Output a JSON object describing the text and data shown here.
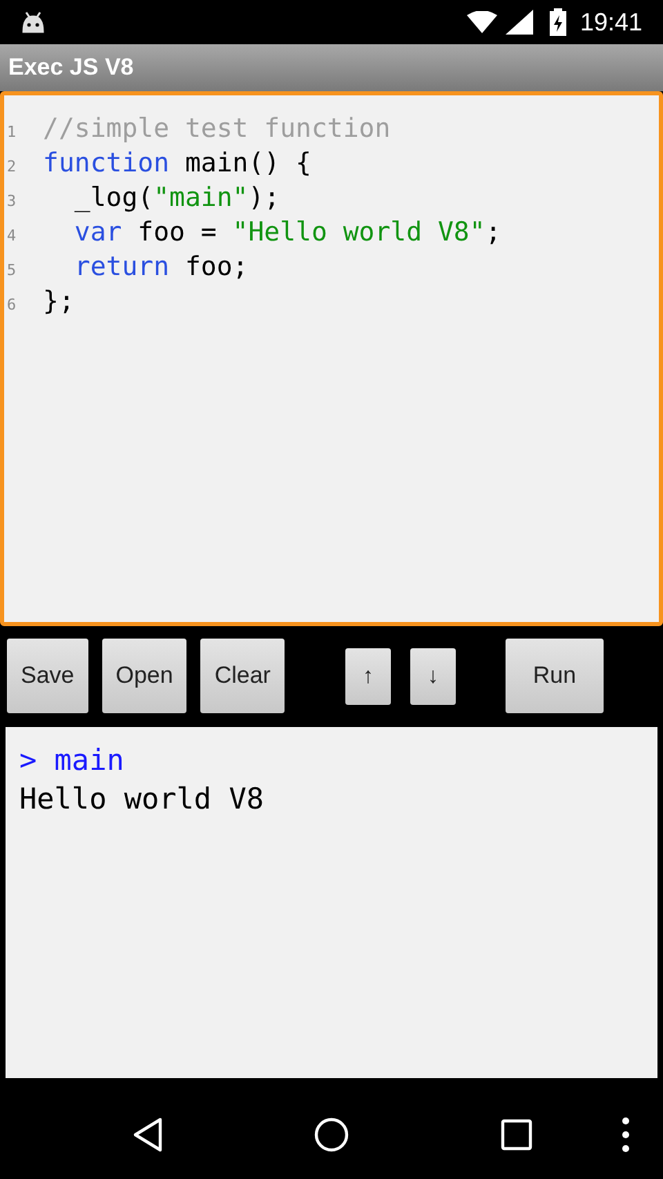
{
  "status_bar": {
    "time": "19:41"
  },
  "app_bar": {
    "title": "Exec JS V8"
  },
  "editor": {
    "focused": true,
    "lines": [
      {
        "number": "1",
        "tokens": [
          {
            "kind": "comment",
            "text": "//simple test function"
          }
        ]
      },
      {
        "number": "2",
        "tokens": [
          {
            "kind": "keyword",
            "text": "function"
          },
          {
            "kind": "plain",
            "text": " main() {"
          }
        ]
      },
      {
        "number": "3",
        "tokens": [
          {
            "kind": "plain",
            "text": "  _log("
          },
          {
            "kind": "string",
            "text": "\"main\""
          },
          {
            "kind": "plain",
            "text": ");"
          }
        ]
      },
      {
        "number": "4",
        "tokens": [
          {
            "kind": "keyword",
            "text": "  var"
          },
          {
            "kind": "plain",
            "text": " foo = "
          },
          {
            "kind": "string",
            "text": "\"Hello world V8\""
          },
          {
            "kind": "plain",
            "text": ";"
          }
        ]
      },
      {
        "number": "5",
        "tokens": [
          {
            "kind": "keyword",
            "text": "  return"
          },
          {
            "kind": "plain",
            "text": " foo;"
          }
        ]
      },
      {
        "number": "6",
        "tokens": [
          {
            "kind": "plain",
            "text": "};"
          }
        ]
      }
    ]
  },
  "toolbar": [
    {
      "label": "Save",
      "kind": "text"
    },
    {
      "label": "Open",
      "kind": "text"
    },
    {
      "label": "Clear",
      "kind": "text"
    },
    {
      "label": "↑",
      "kind": "arrow"
    },
    {
      "label": "↓",
      "kind": "arrow"
    },
    {
      "label": "Run",
      "kind": "run"
    }
  ],
  "console": [
    {
      "kind": "input",
      "prompt": ">",
      "text": "main"
    },
    {
      "kind": "output",
      "text": "Hello world V8"
    }
  ]
}
